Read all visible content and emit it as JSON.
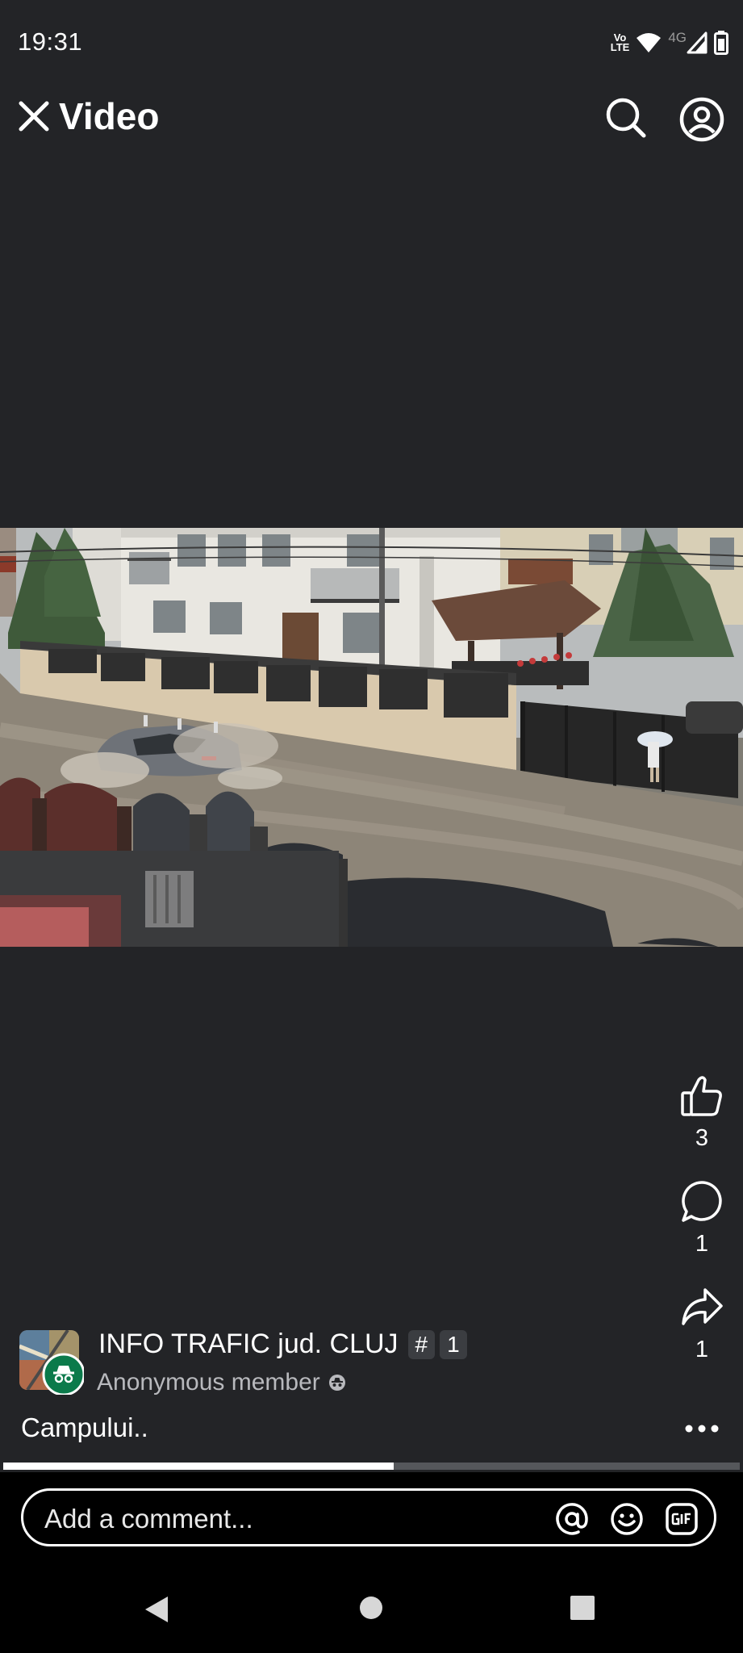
{
  "status_bar": {
    "time": "19:31",
    "volte_top": "Vo",
    "volte_bottom": "LTE",
    "network": "4G"
  },
  "header": {
    "title": "Video",
    "icons": [
      "close-icon",
      "search-icon",
      "profile-icon"
    ]
  },
  "video": {
    "scene": "flooded-street-with-car",
    "progress_percent": 53
  },
  "actions": {
    "likes": "3",
    "comments": "1",
    "shares": "1"
  },
  "post": {
    "group_name": "INFO TRAFIC jud. CLUJ",
    "badge_symbol": "#",
    "badge_number": "1",
    "author": "Anonymous member",
    "caption": "Campului.."
  },
  "comment": {
    "placeholder": "Add a comment...",
    "icons": [
      "at-icon",
      "emoji-icon",
      "gif-icon"
    ]
  },
  "colors": {
    "background": "#232427",
    "comment_bar": "#000000",
    "progress_track": "#55575b",
    "progress_fill": "#ffffff",
    "avatar_badge": "#0b7a4b"
  }
}
